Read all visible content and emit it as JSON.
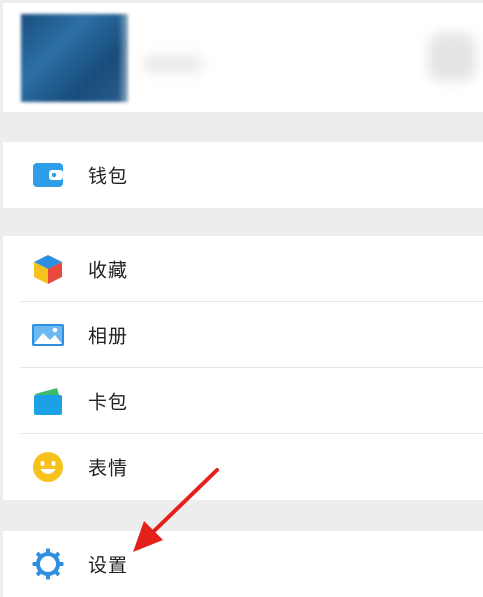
{
  "menu": {
    "wallet": {
      "label": "钱包",
      "icon": "wallet-icon"
    },
    "items": [
      {
        "label": "收藏",
        "icon": "favorites-cube-icon"
      },
      {
        "label": "相册",
        "icon": "album-picture-icon"
      },
      {
        "label": "卡包",
        "icon": "card-wallet-icon"
      },
      {
        "label": "表情",
        "icon": "smiley-face-icon"
      }
    ],
    "settings": {
      "label": "设置",
      "icon": "gear-icon"
    }
  },
  "colors": {
    "background": "#ededed",
    "row": "#ffffff",
    "wallet": "#2e9ee8",
    "album": "#2f8fe0",
    "card": "#1aa1e6",
    "smiley": "#f6c21b",
    "settings": "#2f8fe0",
    "arrow": "#e5201a"
  }
}
